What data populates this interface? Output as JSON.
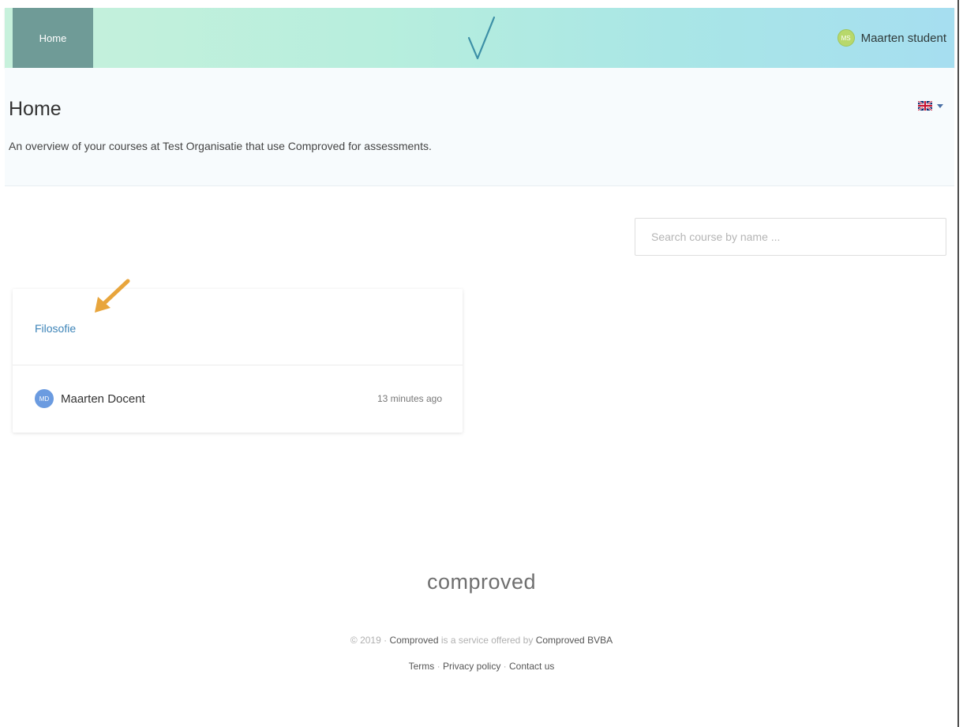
{
  "navbar": {
    "home_label": "Home",
    "user": {
      "initials": "MS",
      "name": "Maarten student"
    }
  },
  "header": {
    "title": "Home",
    "subtitle": "An overview of your courses at Test Organisatie that use Comproved for assessments.",
    "language": "en-GB flag"
  },
  "search": {
    "placeholder": "Search course by name ..."
  },
  "courses": [
    {
      "title": "Filosofie",
      "teacher_initials": "MD",
      "teacher": "Maarten Docent",
      "updated": "13 minutes ago"
    }
  ],
  "footer": {
    "logo": "comproved",
    "copyright": "© 2019",
    "sep": "·",
    "brand": "Comproved",
    "service_text": "is a service offered by",
    "company": "Comproved BVBA",
    "links": [
      "Terms",
      "Privacy policy",
      "Contact us"
    ]
  },
  "colors": {
    "nav_home_bg": "#6f9b97",
    "link": "#3d84b8",
    "annotation_arrow": "#e8a53c"
  }
}
